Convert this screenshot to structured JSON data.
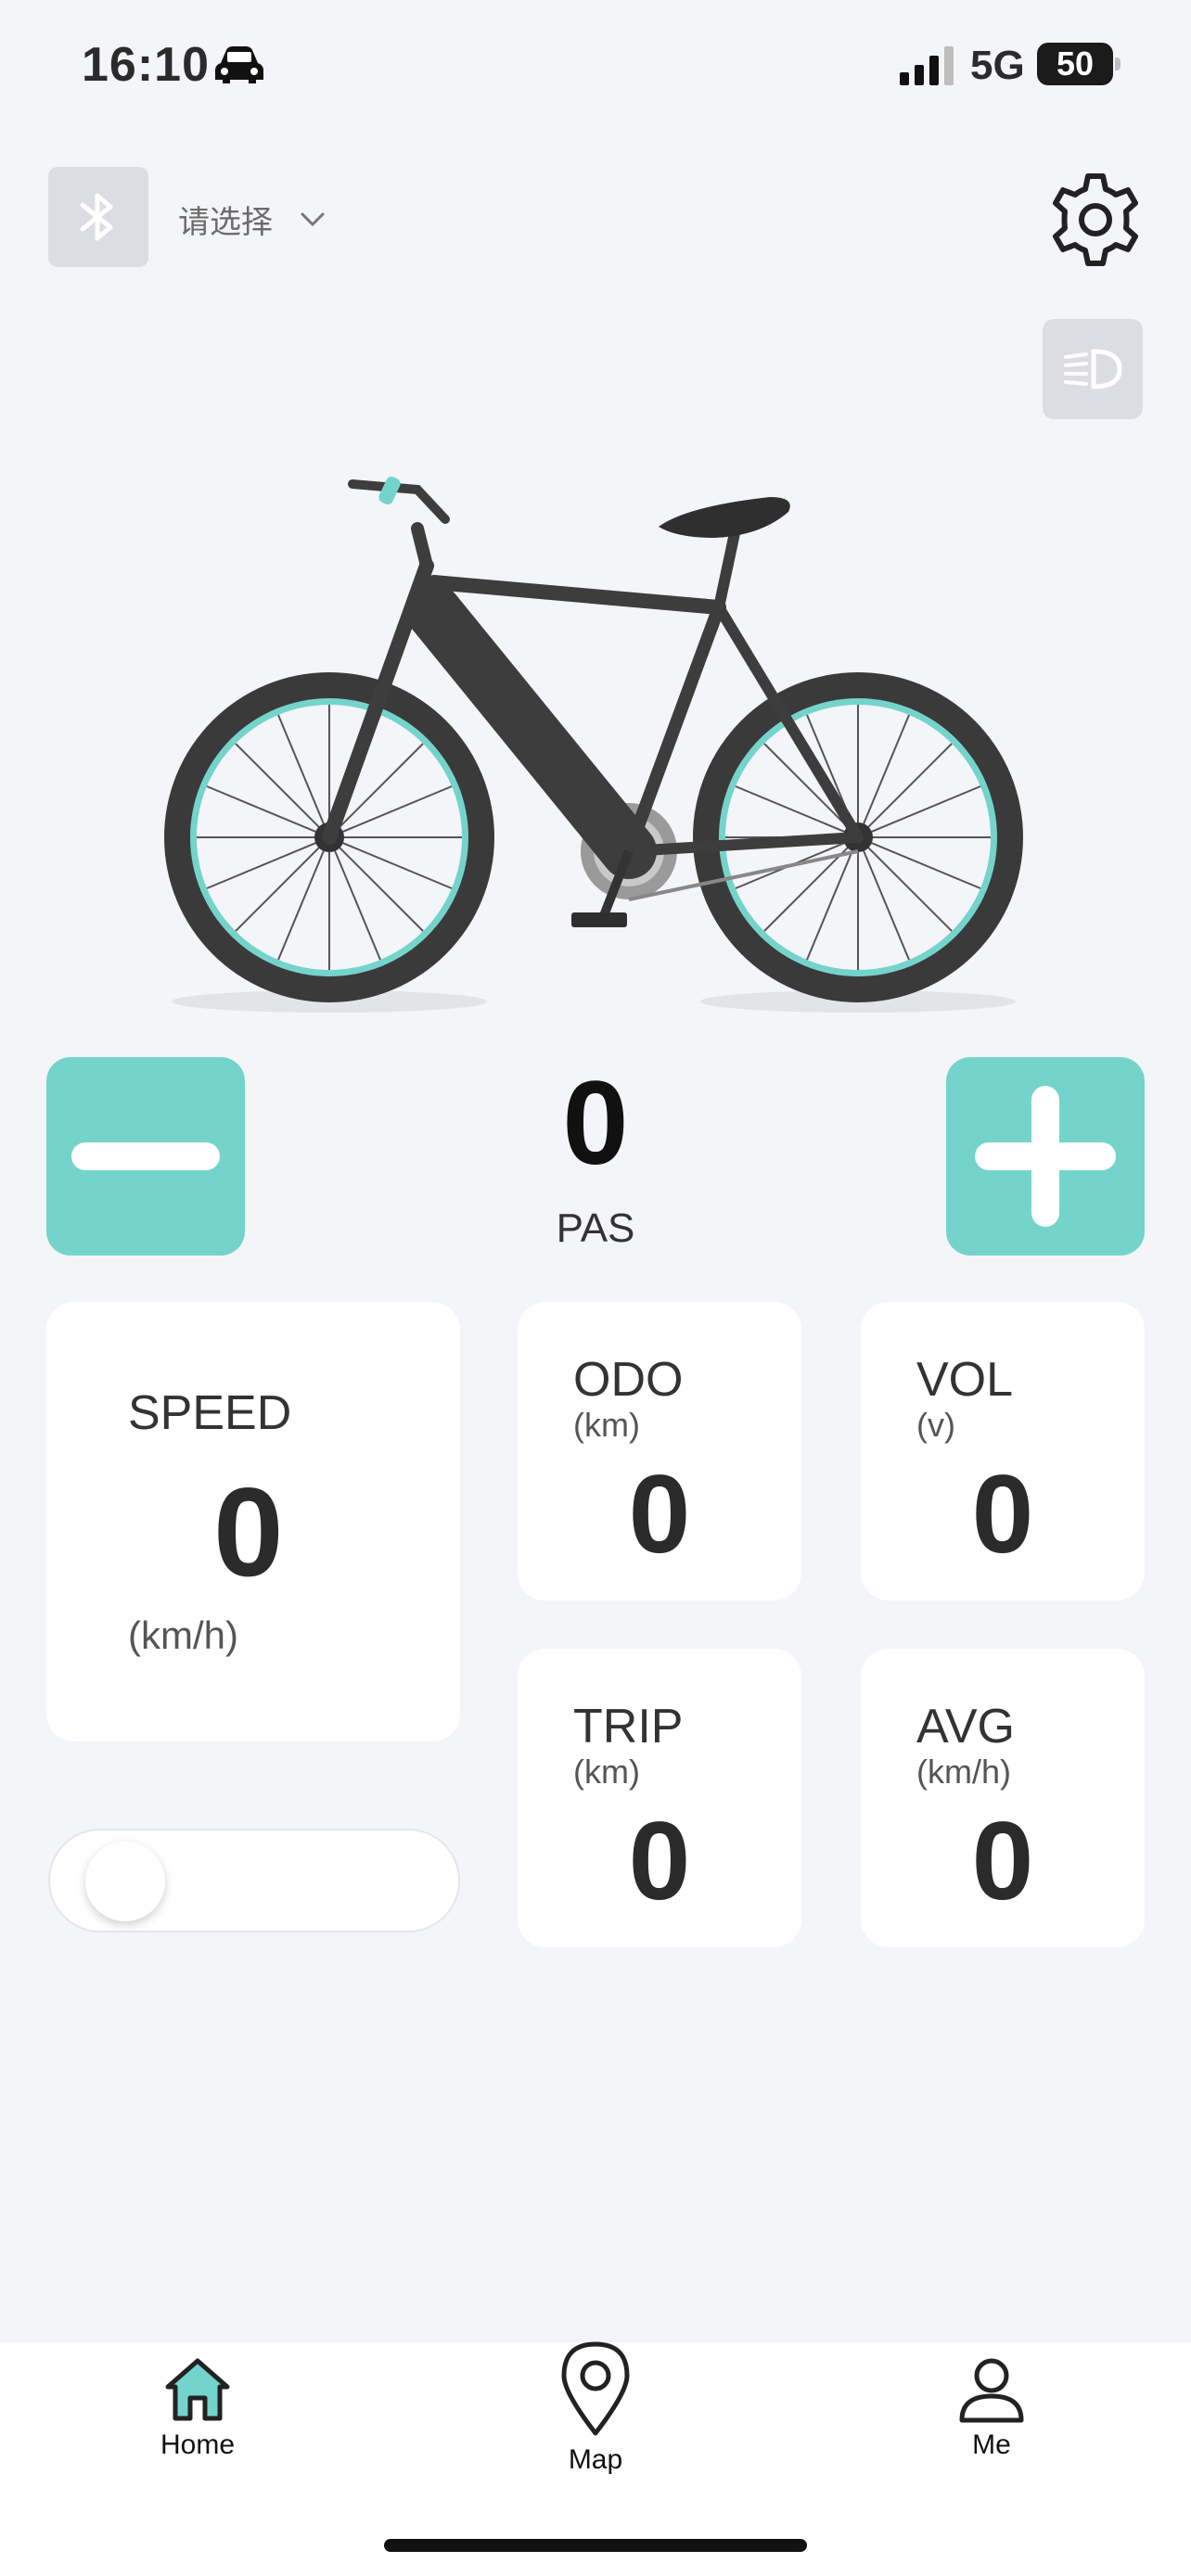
{
  "status_bar": {
    "time": "16:10",
    "network": "5G",
    "battery": "50"
  },
  "header": {
    "device_select_placeholder": "请选择"
  },
  "pas": {
    "value": "0",
    "label": "PAS"
  },
  "stats": {
    "speed": {
      "title": "SPEED",
      "value": "0",
      "unit": "(km/h)"
    },
    "odo": {
      "title": "ODO",
      "unit": "(km)",
      "value": "0"
    },
    "vol": {
      "title": "VOL",
      "unit": "(v)",
      "value": "0"
    },
    "trip": {
      "title": "TRIP",
      "unit": "(km)",
      "value": "0"
    },
    "avg": {
      "title": "AVG",
      "unit": "(km/h)",
      "value": "0"
    }
  },
  "toggle": {
    "on": false
  },
  "nav": {
    "home": "Home",
    "map": "Map",
    "me": "Me"
  },
  "colors": {
    "accent": "#74d4cc",
    "background": "#f4f5f9",
    "card": "#ffffff",
    "button_gray": "#dcdde2"
  },
  "icons": [
    "car-icon",
    "signal-icon",
    "bluetooth-icon",
    "chevron-down-icon",
    "gear-icon",
    "headlight-icon",
    "minus-icon",
    "plus-icon",
    "home-icon",
    "map-pin-icon",
    "person-icon"
  ]
}
